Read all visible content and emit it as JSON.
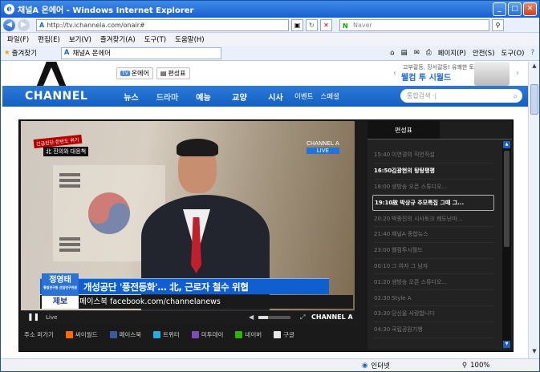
{
  "browser": {
    "title": "채널A 온에어 - Windows Internet Explorer",
    "url": "http://tv.ichannela.com/onair#",
    "search_placeholder": "Naver",
    "menu": [
      "파일(F)",
      "편집(E)",
      "보기(V)",
      "즐겨찾기(A)",
      "도구(T)",
      "도움말(H)"
    ],
    "favorites_label": "즐겨찾기",
    "tab_title": "채널A 온에어",
    "toolbar": [
      "페이지(P)",
      "안전(S)",
      "도구(O)"
    ],
    "status_zone": "인터넷",
    "zoom": "100%"
  },
  "site": {
    "top_buttons": [
      {
        "badge": "TV",
        "label": "온에어"
      },
      {
        "badge": "",
        "label": "편성표"
      }
    ],
    "ad": {
      "small": "고부갈등, 장서갈등! 유쾌한 토크쇼",
      "big": "웰컴 투 시월드"
    },
    "logo": "CHANNEL",
    "nav": [
      "뉴스",
      "드라마",
      "예능",
      "교양",
      "시사"
    ],
    "nav_small": [
      "이벤트",
      "스페셜"
    ],
    "search_placeholder": "통합검색 ·|"
  },
  "player": {
    "badge_top": "긴급진단·한반도 위기",
    "badge_sub": "北 진의와 대응책",
    "channel_logo": "CHANNEL A",
    "live_badge": "LIVE",
    "name": "정영태",
    "name_title": "통일연구원 선임연구위원",
    "jebo": "제보",
    "caption": "개성공단 '풍전등화'… 北, 근로자 철수 위협",
    "caption_sub": "페이스북 facebook.com/channelanews",
    "control_live": "Live",
    "control_brand": "CHANNEL A",
    "share_label": "주소 퍼가기",
    "share_items": [
      {
        "label": "싸이월드",
        "color": "#ff6a00"
      },
      {
        "label": "페이스북",
        "color": "#3b5998"
      },
      {
        "label": "트위터",
        "color": "#2aa9e0"
      },
      {
        "label": "미투데이",
        "color": "#7b4bb8"
      },
      {
        "label": "네이버",
        "color": "#2db400"
      },
      {
        "label": "구글",
        "color": "#e8e8e8"
      }
    ]
  },
  "schedule": {
    "tab_active": "편성표",
    "tab_other": "",
    "rows": [
      {
        "time": "15:40",
        "title": "이연경의 직언직설",
        "state": "past"
      },
      {
        "time": "16:50",
        "title": "김광현의 탕탕평평",
        "state": "now"
      },
      {
        "time": "18:00",
        "title": "생방송 오픈 스튜디오...",
        "state": "past"
      },
      {
        "time": "19:10",
        "title": "故 박상규 추모특집 그때 그...",
        "state": "selected"
      },
      {
        "time": "20:20",
        "title": "박종진의 시사토크 쾌도난마...",
        "state": "past"
      },
      {
        "time": "21:40",
        "title": "채널A 종합뉴스",
        "state": "past"
      },
      {
        "time": "23:00",
        "title": "웰컴투시월드",
        "state": "past"
      },
      {
        "time": "00:10",
        "title": "그 여자 그 남자",
        "state": "past"
      },
      {
        "time": "01:20",
        "title": "생방송 오픈 스튜디오...",
        "state": "past"
      },
      {
        "time": "02:30",
        "title": "Style A",
        "state": "past"
      },
      {
        "time": "03:30",
        "title": "당신을 사랑합니다",
        "state": "past"
      },
      {
        "time": "04:30",
        "title": "국립공원기행",
        "state": "past"
      }
    ]
  }
}
